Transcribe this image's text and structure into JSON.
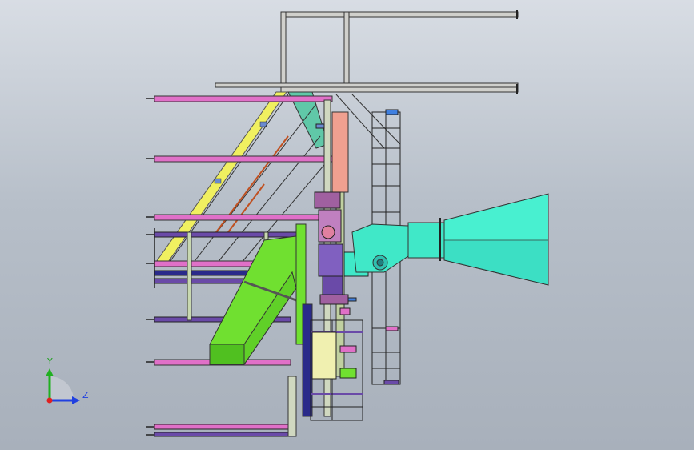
{
  "viewport": {
    "background_top": "#d8dde4",
    "background_bottom": "#a8b0bb"
  },
  "triad": {
    "y_label": "Y",
    "z_label": "Z",
    "x_color": "#e02020",
    "y_color": "#20b020",
    "z_color": "#2040e0"
  },
  "colors": {
    "frame_gray": "#d0d0cc",
    "magenta_beam": "#e070c8",
    "purple_beam": "#6a4aa8",
    "navy_beam": "#2a2a8a",
    "yellow_stair": "#f0f060",
    "green_duct": "#70e030",
    "cyan_cone": "#40e8c8",
    "salmon_panel": "#f0a090",
    "teal_support": "#60c8a8",
    "cream_box": "#f0f0b0"
  }
}
